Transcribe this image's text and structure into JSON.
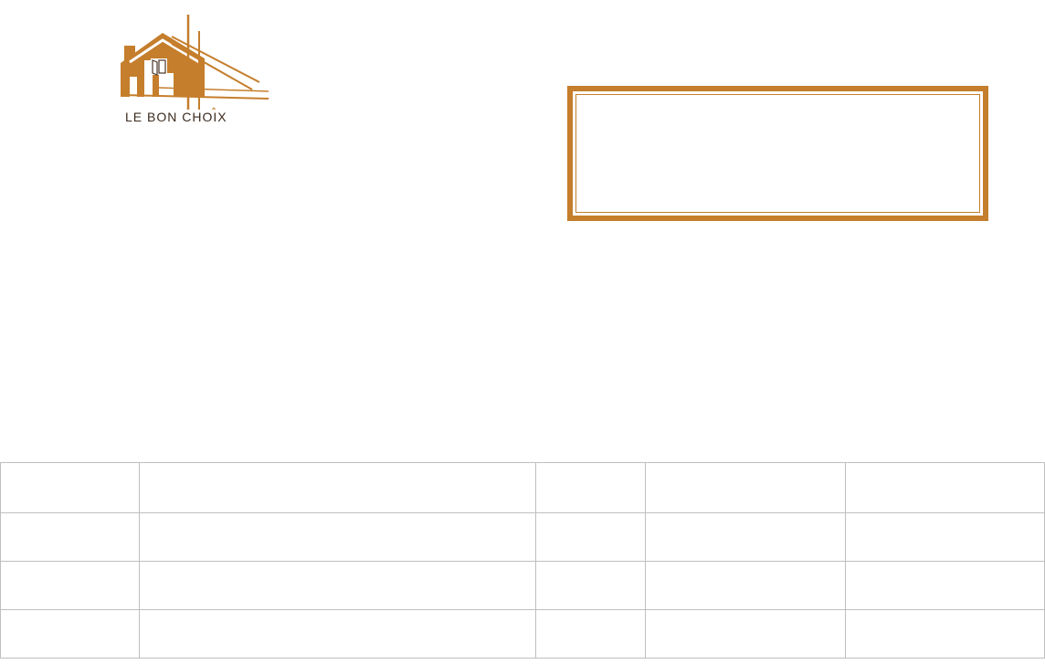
{
  "brand": {
    "name": "LE BON CHOIX",
    "accent": "#c57e2c",
    "text_color": "#3a2a1e"
  },
  "info_box": {
    "border_color": "#c57e2c",
    "lines": []
  },
  "table": {
    "border_color": "#bfbfbf",
    "rows": [
      [
        "",
        "",
        "",
        "",
        ""
      ],
      [
        "",
        "",
        "",
        "",
        ""
      ],
      [
        "",
        "",
        "",
        "",
        ""
      ],
      [
        "",
        "",
        "",
        "",
        ""
      ]
    ]
  }
}
